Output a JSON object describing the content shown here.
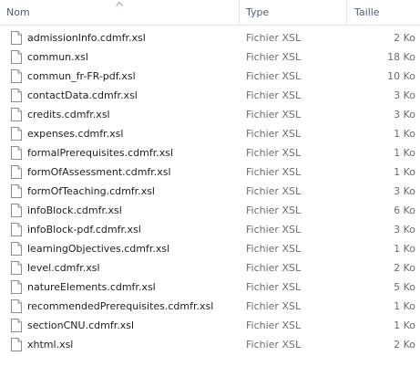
{
  "columns": {
    "name": "Nom",
    "type": "Type",
    "size": "Taille",
    "sort_icon": "sort-ascending-icon"
  },
  "files": [
    {
      "name": "admissionInfo.cdmfr.xsl",
      "type": "Fichier XSL",
      "size": "2 Ko",
      "icon": "xsl-file-icon"
    },
    {
      "name": "commun.xsl",
      "type": "Fichier XSL",
      "size": "18 Ko",
      "icon": "xsl-file-icon"
    },
    {
      "name": "commun_fr-FR-pdf.xsl",
      "type": "Fichier XSL",
      "size": "10 Ko",
      "icon": "xsl-file-icon"
    },
    {
      "name": "contactData.cdmfr.xsl",
      "type": "Fichier XSL",
      "size": "3 Ko",
      "icon": "xsl-file-icon"
    },
    {
      "name": "credits.cdmfr.xsl",
      "type": "Fichier XSL",
      "size": "3 Ko",
      "icon": "xsl-file-icon"
    },
    {
      "name": "expenses.cdmfr.xsl",
      "type": "Fichier XSL",
      "size": "1 Ko",
      "icon": "xsl-file-icon"
    },
    {
      "name": "formalPrerequisites.cdmfr.xsl",
      "type": "Fichier XSL",
      "size": "1 Ko",
      "icon": "xsl-file-icon"
    },
    {
      "name": "formOfAssessment.cdmfr.xsl",
      "type": "Fichier XSL",
      "size": "1 Ko",
      "icon": "xsl-file-icon"
    },
    {
      "name": "formOfTeaching.cdmfr.xsl",
      "type": "Fichier XSL",
      "size": "3 Ko",
      "icon": "xsl-file-icon"
    },
    {
      "name": "infoBlock.cdmfr.xsl",
      "type": "Fichier XSL",
      "size": "6 Ko",
      "icon": "xsl-file-icon"
    },
    {
      "name": "infoBlock-pdf.cdmfr.xsl",
      "type": "Fichier XSL",
      "size": "3 Ko",
      "icon": "xsl-file-icon"
    },
    {
      "name": "learningObjectives.cdmfr.xsl",
      "type": "Fichier XSL",
      "size": "1 Ko",
      "icon": "xsl-file-icon"
    },
    {
      "name": "level.cdmfr.xsl",
      "type": "Fichier XSL",
      "size": "2 Ko",
      "icon": "xsl-file-icon"
    },
    {
      "name": "natureElements.cdmfr.xsl",
      "type": "Fichier XSL",
      "size": "5 Ko",
      "icon": "xsl-file-icon"
    },
    {
      "name": "recommendedPrerequisites.cdmfr.xsl",
      "type": "Fichier XSL",
      "size": "1 Ko",
      "icon": "xsl-file-icon"
    },
    {
      "name": "sectionCNU.cdmfr.xsl",
      "type": "Fichier XSL",
      "size": "1 Ko",
      "icon": "xsl-file-icon"
    },
    {
      "name": "xhtml.xsl",
      "type": "Fichier XSL",
      "size": "2 Ko",
      "icon": "xsl-file-icon"
    }
  ]
}
